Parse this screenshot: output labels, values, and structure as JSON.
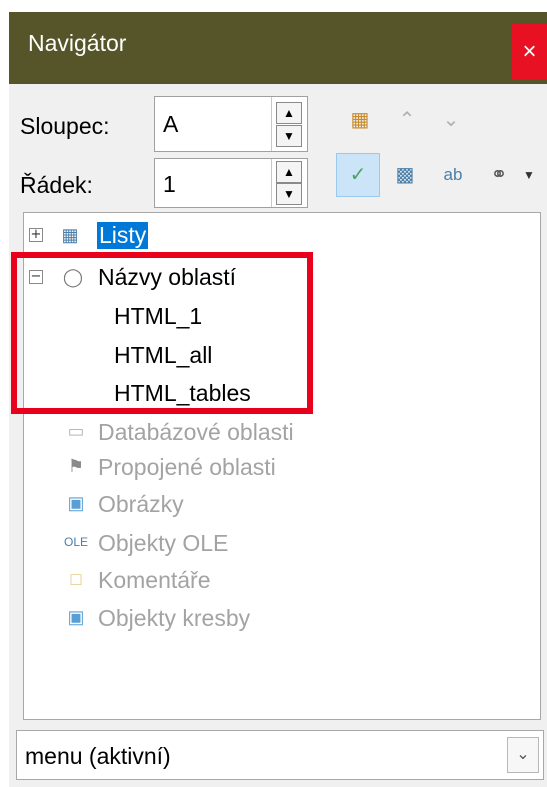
{
  "window": {
    "title": "Navigátor",
    "close_glyph": "×"
  },
  "fields": {
    "column": {
      "label": "Sloupec:",
      "value": "A"
    },
    "row": {
      "label": "Řádek:",
      "value": "1"
    }
  },
  "toolbar": {
    "icons": [
      "data-range-icon",
      "chevron-up-icon",
      "chevron-down-icon",
      "toggle-check-icon",
      "insert-table-icon",
      "rename-icon",
      "globe-link-icon",
      "dropdown-arrow-icon"
    ]
  },
  "tree": {
    "items": [
      {
        "label": "Listy",
        "icon": "sheet-icon",
        "expander": "+"
      },
      {
        "label": "Názvy oblastí",
        "icon": "tag-icon",
        "expander": "−"
      },
      {
        "label": "HTML_1"
      },
      {
        "label": "HTML_all"
      },
      {
        "label": "HTML_tables"
      },
      {
        "label": "Databázové oblasti",
        "icon": "database-icon"
      },
      {
        "label": "Propojené oblasti",
        "icon": "flag-icon"
      },
      {
        "label": "Obrázky",
        "icon": "image-icon"
      },
      {
        "label": "Objekty OLE",
        "icon": "ole-icon"
      },
      {
        "label": "Komentáře",
        "icon": "comment-icon"
      },
      {
        "label": "Objekty kresby",
        "icon": "drawing-icon"
      }
    ]
  },
  "document_select": {
    "value": "menu (aktivní)"
  },
  "colors": {
    "titlebar": "#555529",
    "close": "#e81123",
    "highlight": "#e8001c",
    "selection": "#0078d7"
  }
}
